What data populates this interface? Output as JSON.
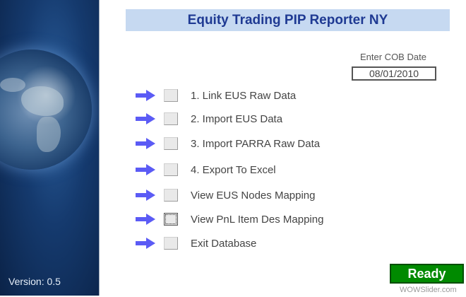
{
  "app": {
    "title": "Equity Trading PIP Reporter NY",
    "version": "Version: 0.5"
  },
  "cob": {
    "label": "Enter COB Date",
    "value": "08/01/2010"
  },
  "menu": [
    {
      "label": "1. Link EUS Raw Data"
    },
    {
      "label": "2. Import EUS Data"
    },
    {
      "label": "3. Import PARRA Raw Data"
    },
    {
      "label": "4. Export To Excel"
    },
    {
      "label": "View EUS Nodes Mapping"
    },
    {
      "label": "View PnL Item Des Mapping"
    },
    {
      "label": "Exit Database"
    }
  ],
  "status": {
    "label": "Ready"
  },
  "watermark": "WOWSlider.com",
  "colors": {
    "arrow": "#5b5bf5",
    "title_bg": "#c6d9f1",
    "title_text": "#1f3a93",
    "ready_bg": "#008a00"
  }
}
